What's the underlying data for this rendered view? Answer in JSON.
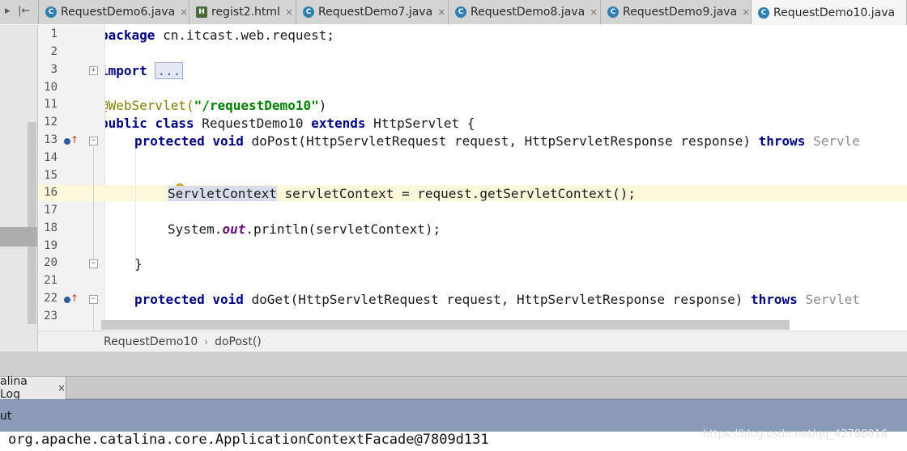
{
  "tabs": [
    {
      "label": "RequestDemo6.java",
      "icon": "java-class-icon",
      "active": false
    },
    {
      "label": "regist2.html",
      "icon": "html-file-icon",
      "active": false
    },
    {
      "label": "RequestDemo7.java",
      "icon": "java-class-icon",
      "active": false
    },
    {
      "label": "RequestDemo8.java",
      "icon": "java-class-icon",
      "active": false
    },
    {
      "label": "RequestDemo9.java",
      "icon": "java-class-icon",
      "active": false
    },
    {
      "label": "RequestDemo10.java",
      "icon": "java-class-icon",
      "active": true
    }
  ],
  "tab_close": "×",
  "tabbar_controls": [
    "▸",
    "|←"
  ],
  "editor": {
    "line_numbers": [
      "1",
      "2",
      "3",
      "10",
      "11",
      "12",
      "13",
      "14",
      "15",
      "16",
      "17",
      "18",
      "19",
      "20",
      "21",
      "22",
      "23"
    ],
    "current_line": "16",
    "lines": {
      "l1": {
        "kw": "package",
        "rest": " cn.itcast.web.request;"
      },
      "l3": {
        "kw": "import",
        "fold": "..."
      },
      "l11": {
        "ann": "@WebServlet(",
        "str": "\"/requestDemo10\"",
        "rest": ")"
      },
      "l12": {
        "kw1": "public",
        "kw2": "class",
        "name": " RequestDemo10 ",
        "kw3": "extends",
        "rest": " HttpServlet {"
      },
      "l13": {
        "kw1": "protected",
        "kw2": "void",
        "rest": " doPost(HttpServletRequest request, HttpServletResponse response) ",
        "kw3": "throws",
        "tail": " Servle"
      },
      "l16": {
        "type": "ServletContext",
        "rest": " servletContext = request.getServletContext();"
      },
      "l18": {
        "pre": "System.",
        "stat": "out",
        "rest": ".println(servletContext);"
      },
      "l20": {
        "rest": "}"
      },
      "l22": {
        "kw1": "protected",
        "kw2": "void",
        "rest": " doGet(HttpServletRequest request, HttpServletResponse response) ",
        "kw3": "throws",
        "tail": " Servlet"
      }
    }
  },
  "breadcrumb": {
    "class": "RequestDemo10",
    "method": "doPost()"
  },
  "tool_window": {
    "tab_label": "alina Log",
    "tab_close": "×",
    "header": "ut",
    "console_output": "org.apache.catalina.core.ApplicationContextFacade@7809d131"
  },
  "watermark": "https://blog.csdn.net/qq_42788016",
  "colors": {
    "keyword": "#000080",
    "annotation": "#808000",
    "string": "#008000",
    "caret_row": "#fcf8dc",
    "tool_header": "#8a9bb8"
  }
}
